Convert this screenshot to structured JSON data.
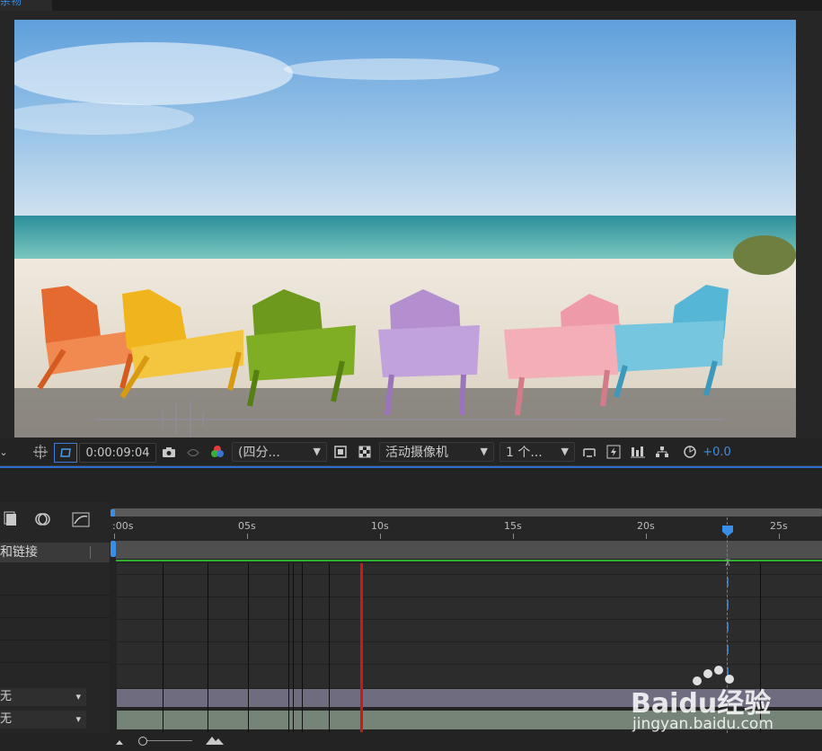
{
  "top_tab": {
    "label": "杂物"
  },
  "viewer": {
    "image": "beach-chairs-composition",
    "chairs": [
      "orange",
      "yellow",
      "green",
      "purple",
      "pink",
      "blue"
    ]
  },
  "toolbar": {
    "region_icon": "region-of-interest-icon",
    "transparency_icon": "transparency-grid-icon",
    "timecode": "0:00:09:04",
    "snapshot_icon": "camera-icon",
    "show_snapshot_icon": "show-snapshot-icon",
    "channel_icon": "rgb-channels-icon",
    "resolution": "(四分...",
    "view_icon": "fast-preview-icon",
    "checker_icon": "checkerboard-icon",
    "camera": "活动摄像机",
    "views": "1 个...",
    "exposure": "+0.0"
  },
  "timeline": {
    "layer_header": "和链接",
    "ticks": [
      ":00s",
      "05s",
      "10s",
      "15s",
      "20s",
      "25s"
    ],
    "tick_seconds": [
      0,
      5,
      10,
      15,
      20,
      25
    ],
    "current_time_seconds": 9.17,
    "marker_seconds": 22.8,
    "layers": [
      {
        "label": "无"
      },
      {
        "label": "无"
      }
    ]
  },
  "watermark": {
    "brand": "Baidu经验",
    "url": "jingyan.baidu.com"
  },
  "colors": {
    "accent": "#2d6fd1",
    "cti": "#d11616",
    "work_area_green": "#2fae2f"
  }
}
